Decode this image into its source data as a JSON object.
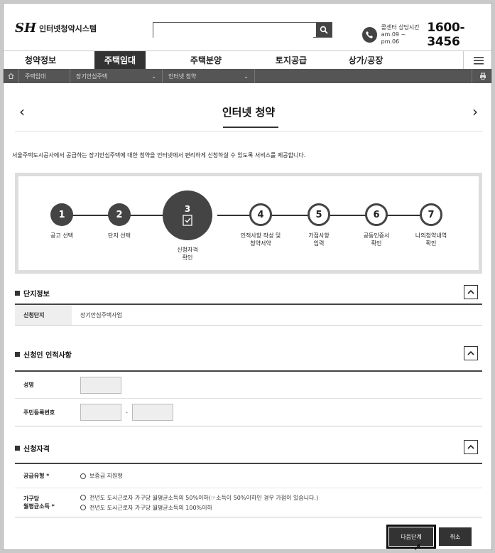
{
  "header": {
    "logo_mark": "SH",
    "logo_text": "인터넷청약시스템",
    "search_placeholder": "",
    "call_hours_line1": "콜센터 상담시간",
    "call_hours_line2": "am.09 ~ pm.06",
    "call_number": "1600-3456"
  },
  "gnb": [
    {
      "label": "청약정보",
      "active": false
    },
    {
      "label": "주택임대",
      "active": true
    },
    {
      "label": "주택분양",
      "active": false
    },
    {
      "label": "토지공급",
      "active": false
    },
    {
      "label": "상가/공장",
      "active": false
    }
  ],
  "breadcrumb": {
    "item1": "주택임대",
    "item2": "장기안심주택",
    "item3": "인터넷 청약"
  },
  "page": {
    "title": "인터넷 청약",
    "intro": "서울주택도시공사에서 공급하는 장기안심주택에 대한 청약을 인터넷에서 편리하게 신청하실 수 있도록 서비스를 제공합니다."
  },
  "steps": [
    {
      "num": "1",
      "label": "공고 선택",
      "label2": "",
      "state": "done"
    },
    {
      "num": "2",
      "label": "단지 선택",
      "label2": "",
      "state": "done"
    },
    {
      "num": "3",
      "label": "신청자격",
      "label2": "확인",
      "state": "current"
    },
    {
      "num": "4",
      "label": "인적사항 작성 및",
      "label2": "청약서약",
      "state": "todo"
    },
    {
      "num": "5",
      "label": "가점사항",
      "label2": "입력",
      "state": "todo"
    },
    {
      "num": "6",
      "label": "공동인증서",
      "label2": "확인",
      "state": "todo"
    },
    {
      "num": "7",
      "label": "나의청약내역",
      "label2": "확인",
      "state": "todo"
    }
  ],
  "sections": {
    "complex": {
      "title": "단지정보",
      "row_label": "신청단지",
      "row_value": "장기안심주택사업"
    },
    "applicant": {
      "title": "신청인 인적사항",
      "name_label": "성명",
      "rrn_label": "주민등록번호",
      "rrn_sep": "-"
    },
    "qualification": {
      "title": "신청자격",
      "supply_label": "공급유형 *",
      "supply_option": "보증금 지원형",
      "income_label1": "가구당",
      "income_label2": "월평균소득 *",
      "income_option1": "전년도 도시근로자 가구당 월평균소득의 50%이하(☞소득이 50%이하인 경우 가점이 있습니다.)",
      "income_option2": "전년도 도시근로자 가구당 월평균소득의 100%이하"
    }
  },
  "buttons": {
    "next": "다음단계",
    "cancel": "취소"
  }
}
